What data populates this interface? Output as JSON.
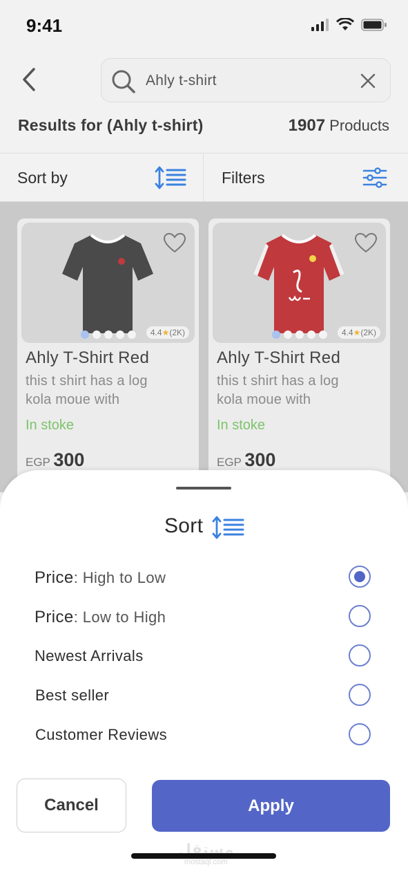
{
  "status": {
    "time": "9:41"
  },
  "search": {
    "query": "Ahly t-shirt"
  },
  "results": {
    "title": "Results for (Ahly t-shirt)",
    "count": "1907",
    "count_unit": "Products"
  },
  "toolbar": {
    "sort_label": "Sort by",
    "filter_label": "Filters"
  },
  "products": [
    {
      "name": "Ahly T-Shirt Red",
      "desc_line1": "this t shirt has a log",
      "desc_line2": "kola moue with",
      "stock": "In stoke",
      "currency": "EGP",
      "price": "300",
      "rating": "4.4",
      "reviews": "(2K)",
      "shirt_color": "#4a4a4a"
    },
    {
      "name": "Ahly T-Shirt Red",
      "desc_line1": "this t shirt has a log",
      "desc_line2": "kola moue with",
      "stock": "In stoke",
      "currency": "EGP",
      "price": "300",
      "rating": "4.4",
      "reviews": "(2K)",
      "shirt_color": "#c0393d"
    }
  ],
  "sort_sheet": {
    "title": "Sort",
    "options": [
      {
        "strong": "Price",
        "weak": ": High to Low",
        "selected": true
      },
      {
        "strong": "Price",
        "weak": ": Low to High",
        "selected": false
      },
      {
        "strong": "Newest Arrivals",
        "weak": "",
        "selected": false
      },
      {
        "strong": "Best seller",
        "weak": "",
        "selected": false
      },
      {
        "strong": "Customer Reviews",
        "weak": "",
        "selected": false
      }
    ],
    "cancel_label": "Cancel",
    "apply_label": "Apply"
  },
  "watermark": {
    "arabic": "مستقل",
    "latin": "mostaql.com"
  },
  "colors": {
    "accent": "#5366c8",
    "stock_green": "#7cc46b",
    "icon_blue": "#3b82e0"
  }
}
